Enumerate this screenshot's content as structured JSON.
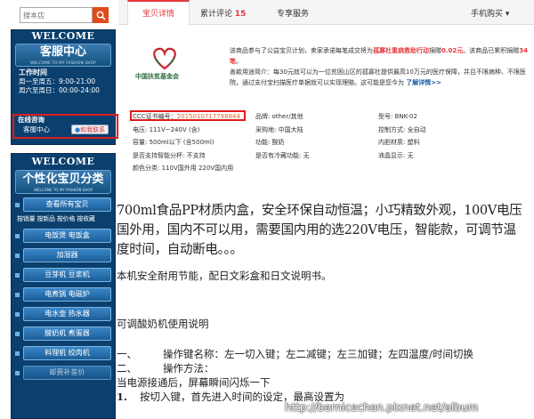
{
  "search": {
    "placeholder": "搜本店"
  },
  "service_panel": {
    "welcome": "WELCOME",
    "title": "客服中心",
    "subtitle": "WELCOME TO MY FASHION SHOP",
    "hours_title": "工作时间",
    "hours": [
      "周一至周五：9:00-21:00",
      "周六至周日：00:00-24:00"
    ],
    "online_title": "在线咨询",
    "online_label": "客服中心",
    "online_button": "和我联系"
  },
  "category_panel": {
    "welcome": "WELCOME",
    "title": "个性化宝贝分类",
    "subtitle": "WELCOME TO MY FASHION SHOP",
    "all_label": "查看所有宝贝",
    "sort_options": [
      "按销量",
      "按新品",
      "按价格",
      "按收藏"
    ],
    "categories": [
      "电饭煲 电饭盒",
      "加湿器",
      "豆芽机 豆浆机",
      "电煮锅 电磁炉",
      "电水壶 热水器",
      "酸奶机 煮蛋器",
      "料理机 绞肉机"
    ],
    "last_partial": "邮费补差价"
  },
  "tabs": [
    {
      "label": "宝贝详情"
    },
    {
      "label": "累计评论",
      "count": "15"
    },
    {
      "label": "专享服务"
    },
    {
      "label": "手机购买 ▾"
    }
  ],
  "charity": {
    "logo_text": "中国扶贫基金会",
    "line1_a": "该商品参与了公益宝贝计划，卖家承诺每笔成交将为",
    "line1_red": "孤寡社重病救助行动",
    "line1_b": "捐赠",
    "line1_amt": "0.02元",
    "line1_c": "。该商品已累积捐赠",
    "line1_amt2": "34笔",
    "line1_d": "。",
    "line2": "善款用途简介：每30元就可以为一位贫困山区的孤寡社提供最高10万元的医疗保障，并且不限病种、不限医院，通过支付宝扫描医疗单据就可以实现理赔。这可能是您今为",
    "more": "了解详情>>"
  },
  "attributes": {
    "ccc_label": "CCC证书编号：",
    "ccc_value": "2015010717798844",
    "rows": [
      [
        "品牌: other/其他",
        "型号: BNK-02"
      ],
      [
        "电压: 111V~240V (含)",
        "采购地: 中国大陆",
        "控制方式: 全自动"
      ],
      [
        "容量: 500ml以下 (含500ml)",
        "功能: 酸奶",
        "内胆材质: 塑料"
      ],
      [
        "是否支持智能分杯: 不支持",
        "是否有冷藏功能: 无",
        "液晶显示: 无"
      ],
      [
        "颜色分类: 110V国外用 220V国内用"
      ]
    ]
  },
  "description": {
    "para1": "700ml食品PP材质内盒，安全环保自动恒温；小巧精致外观，100V电压国外用，国内不可以用，需要国内用的选220V电压，智能款，可调节温度时间，自动断电。。。",
    "para2": "本机安全耐用节能，配日文彩盒和日文说明书。",
    "para3": "可调酸奶机使用说明",
    "item1_no": "一、",
    "item1": "操作键名称：左一切入键；左二减键；左三加键；左四温度/时间切换",
    "item2_no": "二、",
    "item2": "操作方法：",
    "line3": "当电源接通后，屏幕瞬间闪烁一下",
    "line4_no": "1.",
    "line4": "按切入键，首先进入时间的设定，最高设置为"
  },
  "watermark": "http://bernicechen.pixnet.net/album"
}
